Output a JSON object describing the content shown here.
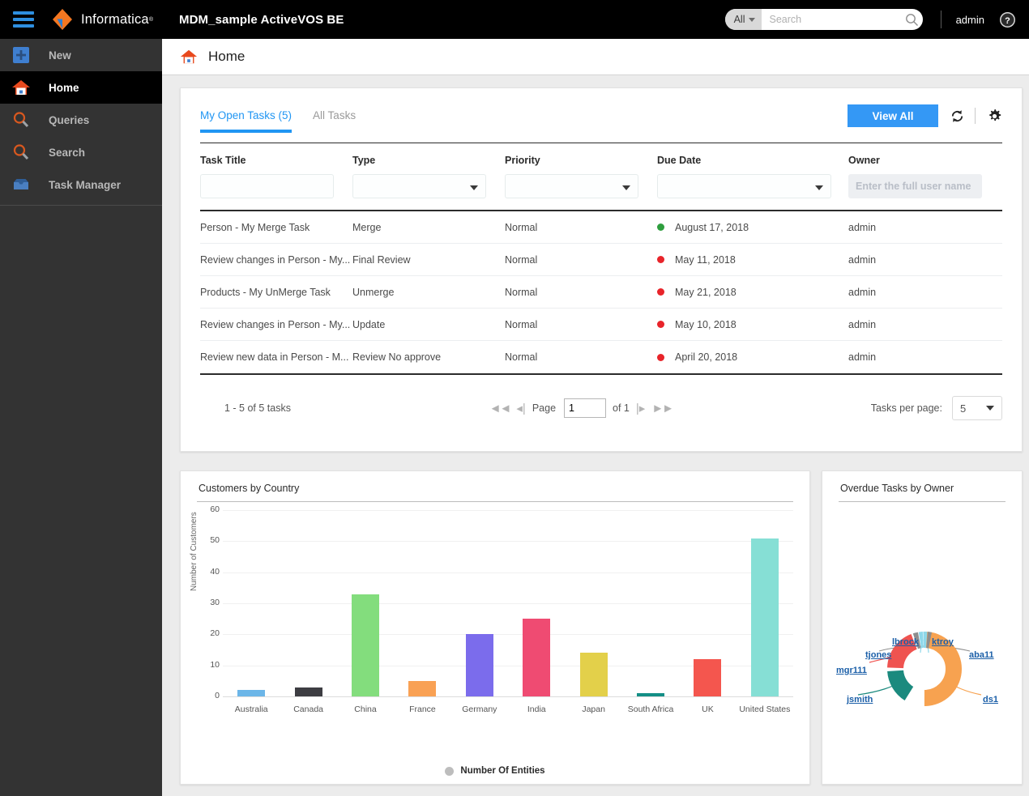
{
  "topbar": {
    "menu_icon": "hamburger-icon",
    "brand": "Informatica",
    "brand_tm": "®",
    "app_title": "MDM_sample ActiveVOS BE",
    "search_scope": "All",
    "search_placeholder": "Search",
    "search_value": "",
    "search_icon": "search-icon",
    "user": "admin",
    "help_icon": "help-icon"
  },
  "sidebar": {
    "items": [
      {
        "label": "New",
        "icon": "plus-square-icon",
        "active": false
      },
      {
        "label": "Home",
        "icon": "home-icon",
        "active": true
      },
      {
        "label": "Queries",
        "icon": "magnifier-icon",
        "active": false
      },
      {
        "label": "Search",
        "icon": "magnifier-icon",
        "active": false
      },
      {
        "label": "Task Manager",
        "icon": "inbox-icon",
        "active": false
      }
    ]
  },
  "page_header": {
    "title": "Home",
    "icon": "home-icon"
  },
  "task_panel": {
    "tabs": [
      {
        "label": "My Open Tasks (5)",
        "active": true
      },
      {
        "label": "All Tasks",
        "active": false
      }
    ],
    "view_all_label": "View All",
    "refresh_icon": "refresh-icon",
    "settings_icon": "gear-icon",
    "columns": [
      "Task Title",
      "Type",
      "Priority",
      "Due Date",
      "Owner"
    ],
    "filters": {
      "task_title_value": "",
      "type_value": "",
      "priority_value": "",
      "due_date_value": "",
      "owner_placeholder": "Enter the full user name",
      "owner_value": ""
    },
    "rows": [
      {
        "title": "Person - My Merge Task",
        "type": "Merge",
        "priority": "Normal",
        "due_date": "August 17, 2018",
        "status_color": "#2e9e3e",
        "owner": "admin"
      },
      {
        "title": "Review changes in Person - My...",
        "type": "Final Review",
        "priority": "Normal",
        "due_date": "May 11, 2018",
        "status_color": "#e8242a",
        "owner": "admin"
      },
      {
        "title": "Products - My UnMerge Task",
        "type": "Unmerge",
        "priority": "Normal",
        "due_date": "May 21, 2018",
        "status_color": "#e8242a",
        "owner": "admin"
      },
      {
        "title": "Review changes in Person - My...",
        "type": "Update",
        "priority": "Normal",
        "due_date": "May 10, 2018",
        "status_color": "#e8242a",
        "owner": "admin"
      },
      {
        "title": "Review new data in Person - M...",
        "type": "Review No approve",
        "priority": "Normal",
        "due_date": "April 20, 2018",
        "status_color": "#e8242a",
        "owner": "admin"
      }
    ],
    "pager": {
      "summary": "1 - 5 of 5 tasks",
      "first_icon": "first-page-icon",
      "prev_icon": "prev-page-icon",
      "page_label": "Page",
      "page_value": "1",
      "of_label": "of 1",
      "next_icon": "next-page-icon",
      "last_icon": "last-page-icon",
      "per_page_label": "Tasks per page:",
      "per_page_value": "5"
    }
  },
  "chart_data": [
    {
      "type": "bar",
      "title": "Customers by Country",
      "xlabel": "",
      "ylabel": "Number of Customers",
      "ylim": [
        0,
        60
      ],
      "yticks": [
        0,
        10,
        20,
        30,
        40,
        50,
        60
      ],
      "grid": true,
      "legend": [
        "Number Of Entities"
      ],
      "legend_position": "bottom",
      "categories": [
        "Australia",
        "Canada",
        "China",
        "France",
        "Germany",
        "India",
        "Japan",
        "South Africa",
        "UK",
        "United States"
      ],
      "values": [
        2,
        3,
        33,
        5,
        20,
        25,
        14,
        1,
        12,
        51
      ],
      "colors": [
        "#6cb6e8",
        "#3d3d42",
        "#83dd7d",
        "#f9a154",
        "#7b6cec",
        "#ef4b72",
        "#e3d04a",
        "#148f86",
        "#f4564e",
        "#86dfd5"
      ]
    },
    {
      "type": "pie",
      "title": "Overdue Tasks by Owner",
      "donut": true,
      "labels": [
        "lbrock",
        "ktroy",
        "aba11",
        "ds1",
        "jsmith",
        "mgr111",
        "tjones"
      ],
      "values": [
        1,
        1,
        1,
        10,
        3,
        1,
        4
      ],
      "colors": [
        "#8ed8ea",
        "#8ed8ea",
        "#8b8b8b",
        "#f5a košt"
      ]
    }
  ],
  "donut_chart": {
    "title": "Overdue Tasks by Owner",
    "labels": [
      "lbrock",
      "ktroy",
      "tjones",
      "aba11",
      "mgr111",
      "jsmith",
      "ds1"
    ],
    "segments": [
      {
        "name": "ds1",
        "value": 10,
        "color": "#f7a250"
      },
      {
        "name": "jsmith",
        "value": 3,
        "color": "#1b8a7e"
      },
      {
        "name": "mgr111",
        "value": 4,
        "color": "#ef5350"
      },
      {
        "name": "tjones",
        "value": 1,
        "color": "#8e8e8e"
      },
      {
        "name": "lbrock",
        "value": 1,
        "color": "#8ed8ea"
      },
      {
        "name": "ktroy",
        "value": 1,
        "color": "#8ed8ea"
      },
      {
        "name": "aba11",
        "value": 1,
        "color": "#8e8e8e"
      }
    ]
  }
}
